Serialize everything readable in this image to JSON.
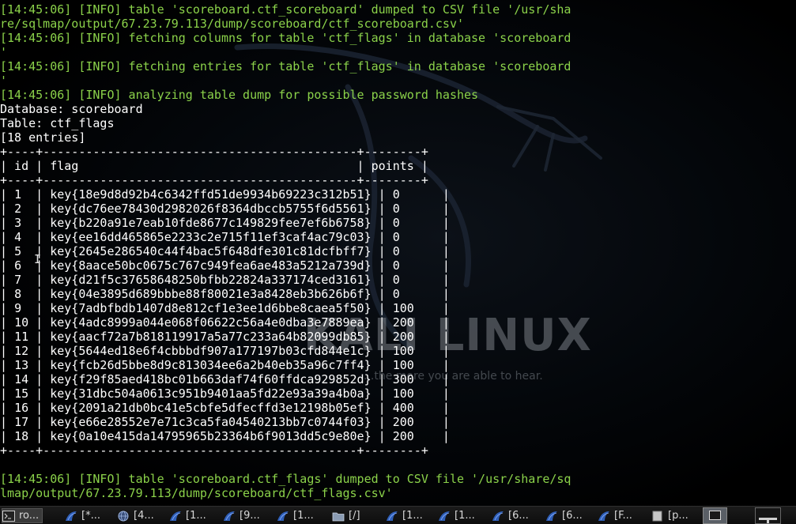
{
  "terminal": {
    "log_lines": [
      {
        "text": "[14:45:06] [INFO] table 'scoreboard.ctf_scoreboard' dumped to CSV file '/usr/sha",
        "style": "info"
      },
      {
        "text": "re/sqlmap/output/67.23.79.113/dump/scoreboard/ctf_scoreboard.csv'",
        "style": "info"
      },
      {
        "text": "[14:45:06] [INFO] fetching columns for table 'ctf_flags' in database 'scoreboard",
        "style": "info"
      },
      {
        "text": "'",
        "style": "info"
      },
      {
        "text": "[14:45:06] [INFO] fetching entries for table 'ctf_flags' in database 'scoreboard",
        "style": "info"
      },
      {
        "text": "'",
        "style": "info"
      },
      {
        "text": "[14:45:06] [INFO] analyzing table dump for possible password hashes",
        "style": "info"
      },
      {
        "text": "Database: scoreboard",
        "style": "plain"
      },
      {
        "text": "Table: ctf_flags",
        "style": "plain"
      },
      {
        "text": "[18 entries]",
        "style": "plain"
      }
    ],
    "table": {
      "border": "+----+--------------------------------------------+--------+",
      "header": "| id | flag                                       | points |",
      "columns": [
        "id",
        "flag",
        "points"
      ],
      "rows": [
        {
          "id": "1",
          "flag": "key{18e9d8d92b4c6342ffd51de9934b69223c312b51}",
          "points": "0"
        },
        {
          "id": "2",
          "flag": "key{dc76ee78430d2982026f8364dbccb5755f6d5561}",
          "points": "0"
        },
        {
          "id": "3",
          "flag": "key{b220a91e7eab10fde8677c149829fee7ef6b6758}",
          "points": "0"
        },
        {
          "id": "4",
          "flag": "key{ee16dd465865e2233c2e715f11ef3caf4ac79c03}",
          "points": "0"
        },
        {
          "id": "5",
          "flag": "key{2645e286540c44f4bac5f648dfe301c81dcfbff7}",
          "points": "0"
        },
        {
          "id": "6",
          "flag": "key{8aace50bc0675c767c949fea6ae483a5212a739d}",
          "points": "0"
        },
        {
          "id": "7",
          "flag": "key{d21f5c37658648250bfbb22824a337174ced3161}",
          "points": "0"
        },
        {
          "id": "8",
          "flag": "key{04e3895d689bbbe88f80021e3a8428eb3b626b6f}",
          "points": "0"
        },
        {
          "id": "9",
          "flag": "key{7adbfbdb1407d8e812cf1e3ee1d6bbe8caea5f50}",
          "points": "100"
        },
        {
          "id": "10",
          "flag": "key{4adc8999a044e068f06622c56a4e0dba3e7889ea}",
          "points": "200"
        },
        {
          "id": "11",
          "flag": "key{aacf72a7b818119917a5a77c233a64b82099db85}",
          "points": "200"
        },
        {
          "id": "12",
          "flag": "key{5644ed18e6f4cbbbdf907a177197b03cfd844e1c}",
          "points": "100"
        },
        {
          "id": "13",
          "flag": "key{fcb26d5bbe8d9c813034ee6a2b40eb35a96c7ff4}",
          "points": "100"
        },
        {
          "id": "14",
          "flag": "key{f29f85aed418bc01b663daf74f60ffdca929852d}",
          "points": "300"
        },
        {
          "id": "15",
          "flag": "key{31dbc504a0613c951b9401aa5fd22e93a39a4b0a}",
          "points": "100"
        },
        {
          "id": "16",
          "flag": "key{2091a21db0bc41e5cbfe5dfecffd3e12198b05ef}",
          "points": "400"
        },
        {
          "id": "17",
          "flag": "key{e66e28552e7e71c3ca5fa04540213bb7c0744f03}",
          "points": "200"
        },
        {
          "id": "18",
          "flag": "key{0a10e415da14795965b23364b6f9013dd5c9e80e}",
          "points": "200"
        }
      ]
    },
    "footer_lines": [
      {
        "text": "",
        "style": "plain"
      },
      {
        "text": "[14:45:06] [INFO] table 'scoreboard.ctf_flags' dumped to CSV file '/usr/share/sq",
        "style": "info"
      },
      {
        "text": "lmap/output/67.23.79.113/dump/scoreboard/ctf_flags.csv'",
        "style": "info"
      }
    ],
    "text_color": "#ffffff",
    "info_color": "#8bd24a"
  },
  "wallpaper": {
    "logo_text": "KALI LINUX",
    "tagline": "...the more you are able to hear."
  },
  "taskbar": {
    "tasks": [
      {
        "label": "ro...",
        "icon": "terminal-icon",
        "active": true
      },
      {
        "label": "[*...",
        "icon": "kali-dragon-icon",
        "active": false
      },
      {
        "label": "[4...",
        "icon": "globe-icon",
        "active": false
      },
      {
        "label": "[1...",
        "icon": "kali-dragon-icon",
        "active": false
      },
      {
        "label": "[9...",
        "icon": "kali-dragon-icon",
        "active": false
      },
      {
        "label": "[1...",
        "icon": "kali-dragon-icon",
        "active": false
      },
      {
        "label": "[/]",
        "icon": "folder-icon",
        "active": false
      },
      {
        "label": "[1...",
        "icon": "kali-dragon-icon",
        "active": false
      },
      {
        "label": "[1...",
        "icon": "kali-dragon-icon",
        "active": false
      },
      {
        "label": "[6...",
        "icon": "kali-dragon-icon",
        "active": false
      },
      {
        "label": "[6...",
        "icon": "kali-dragon-icon",
        "active": false
      },
      {
        "label": "[F...",
        "icon": "kali-dragon-icon",
        "active": false
      },
      {
        "label": "[p...",
        "icon": "window-icon",
        "active": false
      }
    ],
    "tray": [
      "terminal-icon",
      "show-desktop-icon"
    ]
  }
}
